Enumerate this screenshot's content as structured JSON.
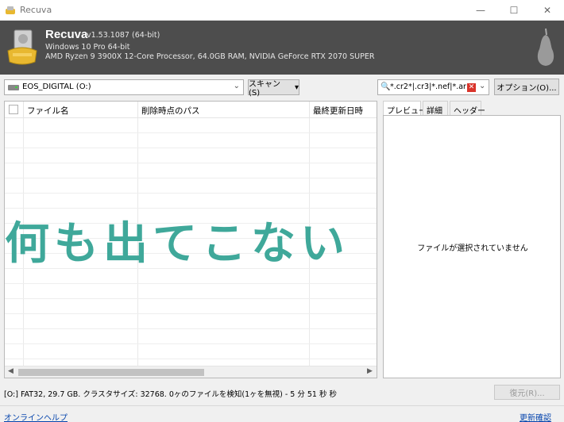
{
  "window": {
    "title": "Recuva",
    "minimize_glyph": "—",
    "maximize_glyph": "☐",
    "close_glyph": "✕"
  },
  "header": {
    "app_name": "Recuva",
    "version": "v1.53.1087 (64-bit)",
    "os": "Windows 10 Pro 64-bit",
    "hardware": "AMD Ryzen 9 3900X 12-Core Processor, 64.0GB RAM, NVIDIA GeForce RTX 2070 SUPER"
  },
  "toolbar": {
    "drive": "EOS_DIGITAL (O:)",
    "scan_label": "スキャン(S)",
    "filter_text": "*.cr2*|.cr3|*.nef|*.arw",
    "options_label": "オプション(O)..."
  },
  "file_list": {
    "columns": [
      "ファイル名",
      "削除時点のパス",
      "最終更新日時"
    ],
    "rows": []
  },
  "overlay": {
    "caption": "何も出てこない"
  },
  "preview": {
    "tabs": [
      "プレビュー",
      "詳細",
      "ヘッダー"
    ],
    "active_tab": "プレビュー",
    "empty_message": "ファイルが選択されていません"
  },
  "status": {
    "text": "[O:] FAT32, 29.7 GB. クラスタサイズ: 32768. 0ヶのファイルを検知(1ヶを無視) - 5 分 51 秒 秒",
    "restore_label": "復元(R)..."
  },
  "footer": {
    "help_link": "オンラインヘルプ",
    "update_link": "更新確認"
  },
  "colors": {
    "header_bg": "#4d4d4d",
    "overlay_text": "#3fa89a",
    "link": "#0645ad"
  }
}
